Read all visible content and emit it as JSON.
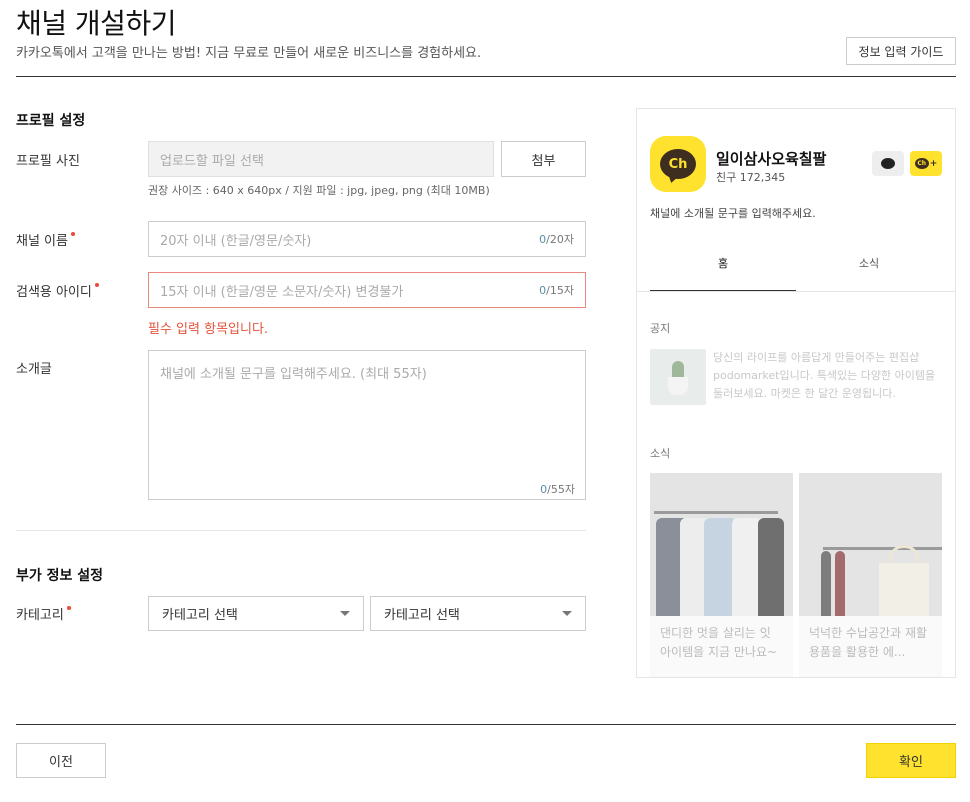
{
  "header": {
    "title": "채널 개설하기",
    "subtitle": "카카오톡에서 고객을 만나는 방법! 지금 무료로 만들어 새로운 비즈니스를 경험하세요.",
    "guide_button": "정보 입력 가이드"
  },
  "profile_section": {
    "title": "프로필 설정",
    "photo": {
      "label": "프로필 사진",
      "placeholder": "업로드할 파일 선택",
      "attach_button": "첨부",
      "hint": "권장 사이즈 : 640 x 640px / 지원 파일 : jpg, jpeg, png (최대 10MB)"
    },
    "channel_name": {
      "label": "채널 이름",
      "placeholder": "20자 이내 (한글/영문/숫자)",
      "count": "0",
      "max": "/20자"
    },
    "search_id": {
      "label": "검색용 아이디",
      "placeholder": "15자 이내 (한글/영문 소문자/숫자) 변경불가",
      "count": "0",
      "max": "/15자",
      "error": "필수 입력 항목입니다."
    },
    "intro": {
      "label": "소개글",
      "placeholder": "채널에 소개될 문구를 입력해주세요. (최대 55자)",
      "count": "0",
      "max": "/55자"
    }
  },
  "extra_section": {
    "title": "부가 정보 설정",
    "category": {
      "label": "카테고리",
      "select1": "카테고리 선택",
      "select2": "카테고리 선택"
    }
  },
  "footer": {
    "prev_button": "이전",
    "ok_button": "확인"
  },
  "preview": {
    "logo_text": "Ch",
    "channel_name": "일이삼사오육칠팔",
    "friends": "친구 172,345",
    "add_logo": "Ch",
    "add_plus": "+",
    "description": "채널에 소개될 문구를 입력해주세요.",
    "tabs": [
      "홈",
      "소식"
    ],
    "notice_title": "공지",
    "notice_text": "당신의 라이프를 아름답게 만들어주는 편집샵 podomarket입니다. 특색있는 다양한 아이템을 둘러보세요. 마켓은 한 달간 운영됩니다.",
    "news_title": "소식",
    "news": [
      "댄디한 멋을 살리는 잇 아이템을 지금 만나요~",
      "넉넉한 수납공간과 재활용품을 활용한 에..."
    ]
  },
  "colors": {
    "accent_yellow": "#fee22d",
    "error_red": "#e2533c",
    "required_dot": "#e94b3c"
  }
}
